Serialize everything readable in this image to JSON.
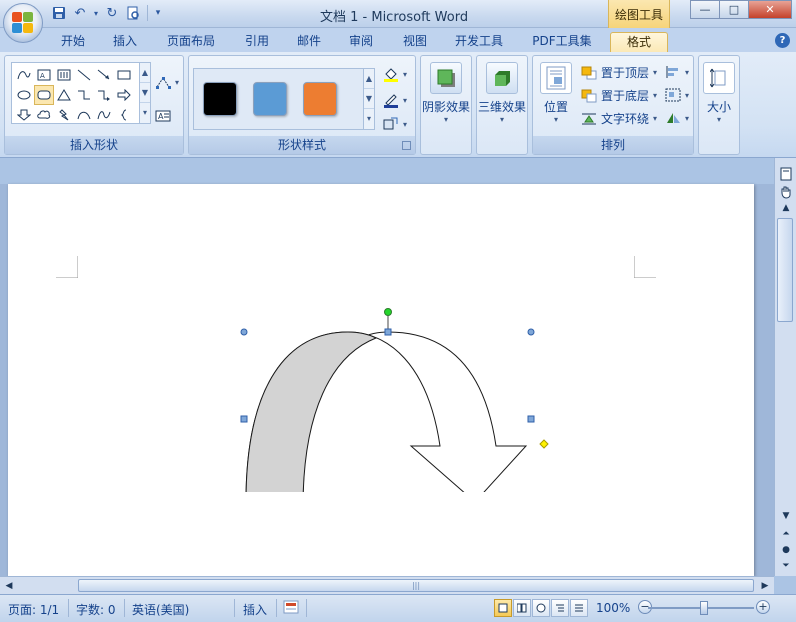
{
  "window": {
    "title": "文档 1 - Microsoft Word",
    "contextual_tab_group": "绘图工具",
    "controls": {
      "minimize": "—",
      "maximize": "□",
      "close": "✕"
    },
    "help": "?"
  },
  "tabs": [
    {
      "label": "开始",
      "active": false
    },
    {
      "label": "插入",
      "active": false
    },
    {
      "label": "页面布局",
      "active": false
    },
    {
      "label": "引用",
      "active": false
    },
    {
      "label": "邮件",
      "active": false
    },
    {
      "label": "审阅",
      "active": false
    },
    {
      "label": "视图",
      "active": false
    },
    {
      "label": "开发工具",
      "active": false
    },
    {
      "label": "PDF工具集",
      "active": false
    },
    {
      "label": "格式",
      "active": true
    }
  ],
  "ribbon": {
    "groups": {
      "insert_shapes": {
        "label": "插入形状"
      },
      "shape_styles": {
        "label": "形状样式",
        "swatches": [
          "#000000",
          "#5b9bd5",
          "#ed7d31"
        ]
      },
      "shadow": {
        "label": "阴影效果"
      },
      "three_d": {
        "label": "三维效果"
      },
      "arrange": {
        "label": "排列",
        "position": "位置",
        "bring_front": "置于顶层",
        "send_back": "置于底层",
        "text_wrap": "文字环绕"
      },
      "size": {
        "label": "大小"
      }
    }
  },
  "document": {
    "shape": "curved-down-arrow",
    "shape_fill": "#ffffff",
    "shape_shade": "#d3d3d3"
  },
  "statusbar": {
    "page": "页面: 1/1",
    "words": "字数: 0",
    "language": "英语(美国)",
    "mode": "插入",
    "zoom": "100%"
  }
}
